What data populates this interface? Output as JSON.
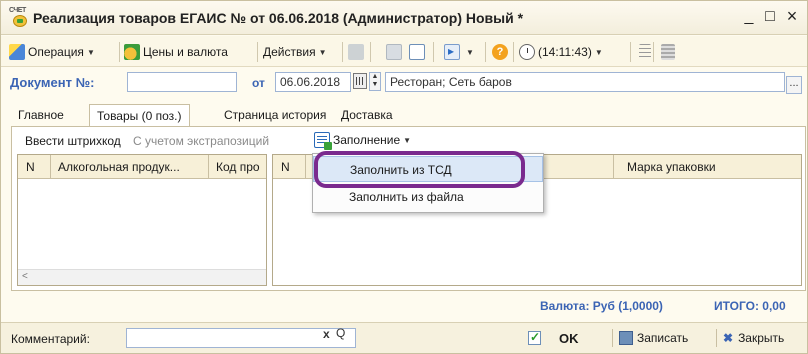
{
  "window": {
    "title": "Реализация товаров ЕГАИС № от 06.06.2018 (Администратор) Новый *",
    "app_icon_text": "СЧЕТ",
    "minimize": "_",
    "maximize": "□",
    "close": "×"
  },
  "toolbar": {
    "operation": "Операция",
    "prices": "Цены и валюта",
    "actions": "Действия",
    "time": "(14:11:43)",
    "help": "?"
  },
  "document": {
    "label": "Документ №:",
    "number_value": "",
    "date_label": "от",
    "date_value": "06.06.2018",
    "spin_up": "▲",
    "spin_down": "▼",
    "store": "Ресторан; Сеть баров",
    "dots": "..."
  },
  "tabs": [
    {
      "label": "Главное"
    },
    {
      "label": "Товары (0 поз.)"
    },
    {
      "label": "Страница история"
    },
    {
      "label": "Доставка"
    }
  ],
  "goods": {
    "scan_barcode": "Ввести штрихкод",
    "with_extrapositions": "С учетом экстрапозиций",
    "fill_button": "Заполнение",
    "left_table": {
      "col_n": "N",
      "col_product": "Алкогольная продук...",
      "col_code": "Код про"
    },
    "right_table": {
      "col_n": "N",
      "col_mark": "Марка упаковки"
    },
    "scroll_left": "<"
  },
  "fill_menu": {
    "items": [
      {
        "label": "Заполнить из ТСД"
      },
      {
        "label": "Заполнить из файла"
      }
    ]
  },
  "totals": {
    "currency": "Валюта: Руб (1,0000)",
    "total": "ИТОГО: 0,00"
  },
  "bottom": {
    "comment_label": "Комментарий:",
    "comment_value": "",
    "clear": "x",
    "search": "Q",
    "ok": "OK",
    "save": "Записать",
    "close": "Закрыть",
    "close_icon": "✖"
  },
  "colors": {
    "accent_blue": "#3b64b4",
    "background": "#fefbef",
    "highlight_ring": "#7a2a8e",
    "menu_highlight": "#dce8f7"
  }
}
